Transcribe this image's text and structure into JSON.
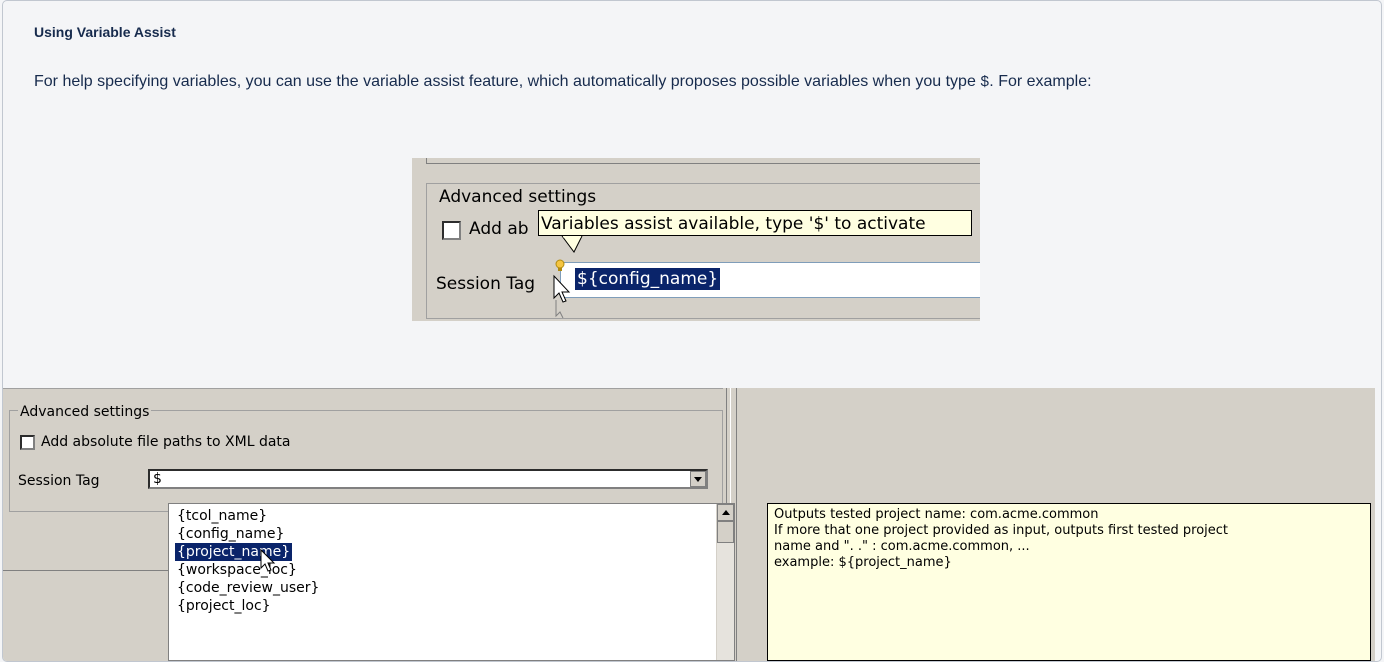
{
  "section": {
    "heading": "Using Variable Assist",
    "paragraph_before": "For help specifying variables, you can use the variable assist feature, which automatically proposes possible variables when you type ",
    "paragraph_code": "$",
    "paragraph_after": ". For example:"
  },
  "screenshot1": {
    "group_label": "Advanced settings",
    "checkbox_label": "Add ab",
    "tooltip": "Variables assist available, type '$' to activate",
    "session_label": "Session Tag",
    "field_value": "${config_name}"
  },
  "screenshot2": {
    "group_label": "Advanced settings",
    "checkbox_label": "Add absolute file paths to XML data",
    "session_label": "Session Tag",
    "combo_value": "$",
    "suggestions": [
      "{tcol_name}",
      "{config_name}",
      "{project_name}",
      "{workspace_loc}",
      "{code_review_user}",
      "{project_loc}"
    ],
    "selected_index": 2,
    "info_lines": [
      "Outputs tested project name: com.acme.common",
      "If more that one project provided as input, outputs first tested project",
      "name and \". .\" : com.acme.common, ...",
      "example: ${project_name}"
    ]
  },
  "colors": {
    "selection": "#0a246a",
    "tooltip_bg": "#ffffe1",
    "dialog_bg": "#d4d0c8",
    "panel_bg": "#f4f5f7"
  }
}
